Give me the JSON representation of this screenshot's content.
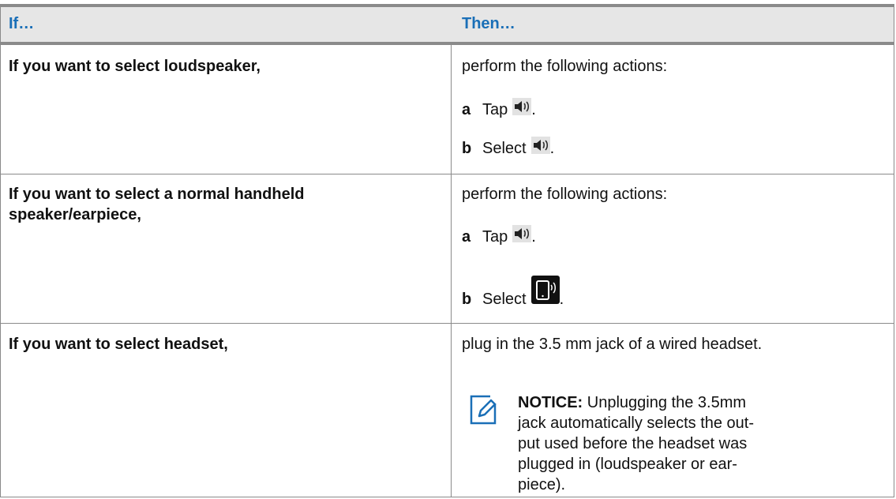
{
  "header": {
    "col1": "If…",
    "col2": "Then…"
  },
  "rows": [
    {
      "condition": "If you want to select loudspeaker,",
      "intro": "perform the following actions:",
      "steps": [
        {
          "letter": "a",
          "text": "Tap",
          "icon": "speaker-icon",
          "suffix": "."
        },
        {
          "letter": "b",
          "text": "Select",
          "icon": "speaker-icon",
          "suffix": "."
        }
      ]
    },
    {
      "condition": "If you want to select a normal handheld speaker/earpiece,",
      "intro": "perform the following actions:",
      "steps": [
        {
          "letter": "a",
          "text": "Tap",
          "icon": "speaker-icon",
          "suffix": "."
        },
        {
          "letter": "b",
          "text": "Select",
          "icon": "phone-earpiece-icon",
          "suffix": "."
        }
      ]
    },
    {
      "condition": "If you want to select headset,",
      "intro": "plug in the 3.5 mm jack of a wired headset.",
      "notice_label": "NOTICE:",
      "notice_text": "Unplugging the 3.5mm jack automatically selects the out-put used before the headset was plugged in (loudspeaker or ear-piece)."
    }
  ],
  "colors": {
    "header_text": "#1a6fb7",
    "header_bg": "#e6e6e6",
    "border": "#8a8a8a",
    "notice_icon": "#1a6fb7"
  }
}
